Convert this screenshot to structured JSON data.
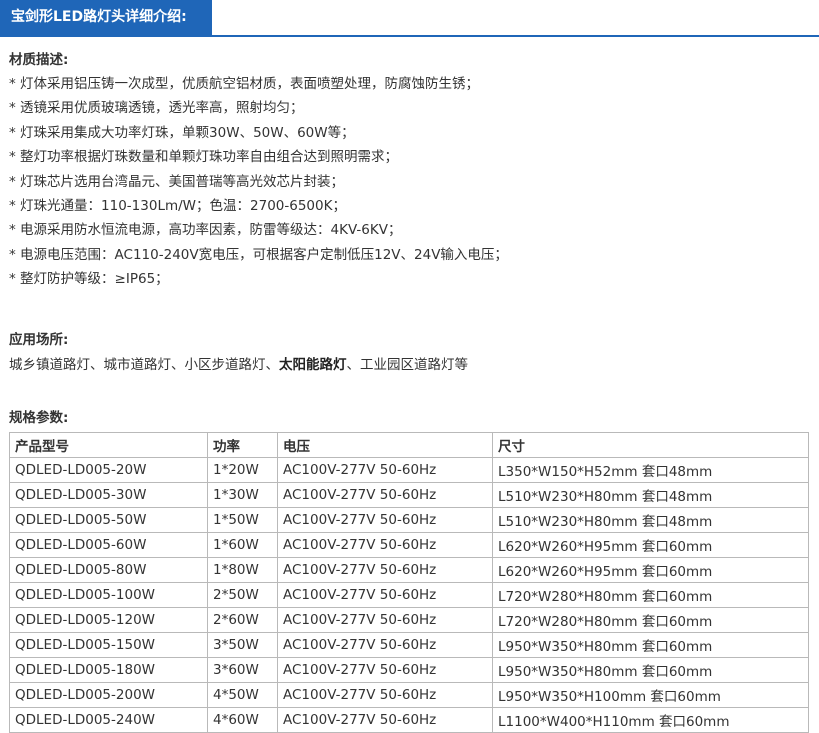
{
  "header": {
    "title": "宝剑形LED路灯头详细介绍:"
  },
  "material": {
    "title": "材质描述:",
    "items": [
      "* 灯体采用铝压铸一次成型，优质航空铝材质，表面喷塑处理，防腐蚀防生锈；",
      "* 透镜采用优质玻璃透镜，透光率高，照射均匀；",
      "* 灯珠采用集成大功率灯珠，单颗30W、50W、60W等；",
      "* 整灯功率根据灯珠数量和单颗灯珠功率自由组合达到照明需求；",
      "* 灯珠芯片选用台湾晶元、美国普瑞等高光效芯片封装；",
      "* 灯珠光通量：110-130Lm/W；色温：2700-6500K；",
      "* 电源采用防水恒流电源，高功率因素，防雷等级达：4KV-6KV；",
      "* 电源电压范围：AC110-240V宽电压，可根据客户定制低压12V、24V输入电压；",
      "* 整灯防护等级：≥IP65；"
    ]
  },
  "application": {
    "title": "应用场所:",
    "text_before": "城乡镇道路灯、城市道路灯、小区步道路灯、",
    "text_bold": "太阳能路灯",
    "text_after": "、工业园区道路灯等"
  },
  "specs": {
    "title": "规格参数:",
    "columns": [
      "产品型号",
      "功率",
      "电压",
      "尺寸"
    ],
    "rows": [
      [
        "QDLED-LD005-20W",
        "1*20W",
        "AC100V-277V 50-60Hz",
        "L350*W150*H52mm 套口48mm"
      ],
      [
        "QDLED-LD005-30W",
        "1*30W",
        "AC100V-277V 50-60Hz",
        "L510*W230*H80mm 套口48mm"
      ],
      [
        "QDLED-LD005-50W",
        "1*50W",
        "AC100V-277V 50-60Hz",
        "L510*W230*H80mm 套口48mm"
      ],
      [
        "QDLED-LD005-60W",
        "1*60W",
        "AC100V-277V 50-60Hz",
        "L620*W260*H95mm 套口60mm"
      ],
      [
        "QDLED-LD005-80W",
        "1*80W",
        "AC100V-277V 50-60Hz",
        "L620*W260*H95mm 套口60mm"
      ],
      [
        "QDLED-LD005-100W",
        "2*50W",
        "AC100V-277V 50-60Hz",
        "L720*W280*H80mm 套口60mm"
      ],
      [
        "QDLED-LD005-120W",
        "2*60W",
        "AC100V-277V 50-60Hz",
        "L720*W280*H80mm 套口60mm"
      ],
      [
        "QDLED-LD005-150W",
        "3*50W",
        "AC100V-277V 50-60Hz",
        "L950*W350*H80mm 套口60mm"
      ],
      [
        "QDLED-LD005-180W",
        "3*60W",
        "AC100V-277V 50-60Hz",
        "L950*W350*H80mm 套口60mm"
      ],
      [
        "QDLED-LD005-200W",
        "4*50W",
        "AC100V-277V 50-60Hz",
        "L950*W350*H100mm 套口60mm"
      ],
      [
        "QDLED-LD005-240W",
        "4*60W",
        "AC100V-277V 50-60Hz",
        "L1100*W400*H110mm 套口60mm"
      ]
    ]
  },
  "colors": {
    "accent": "#1f66b8",
    "text": "#333333",
    "border": "#b9b9b9"
  }
}
